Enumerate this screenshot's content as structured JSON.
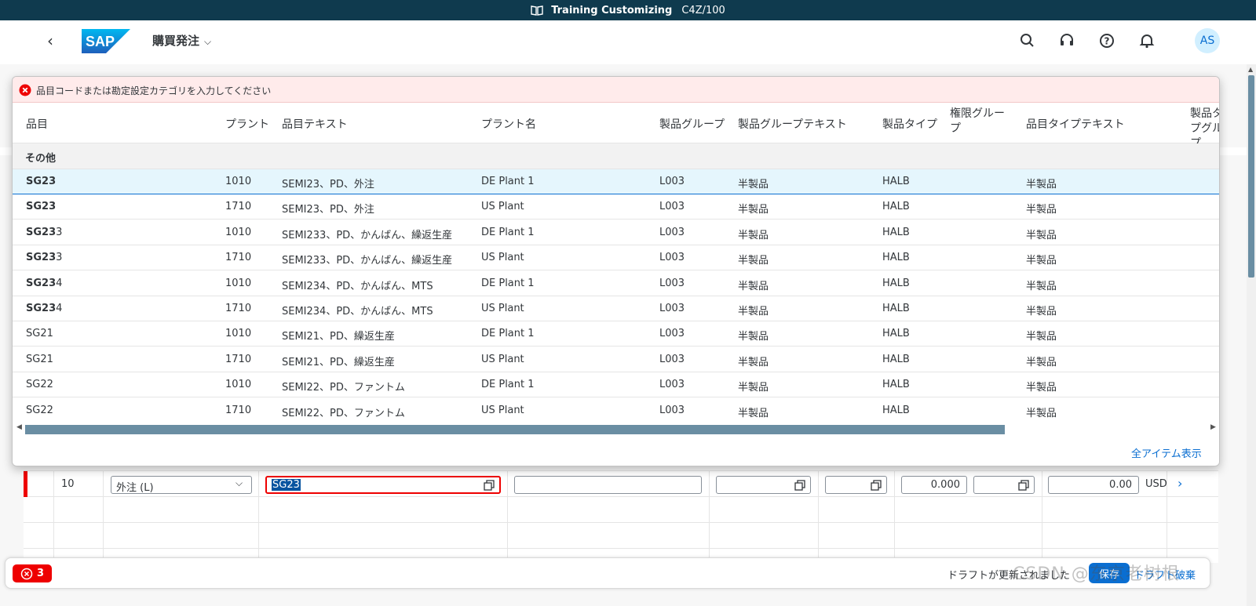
{
  "system_bar": {
    "title": "Training Customizing",
    "system": "C4Z/100"
  },
  "shell": {
    "app_title": "購買発注",
    "logo": "SAP",
    "avatar": "AS"
  },
  "colors": {
    "accent": "#0a6ed1",
    "error": "#e00000",
    "shell_bar": "#0f3a4e"
  },
  "popover": {
    "message": "品目コードまたは勘定設定カテゴリを入力してください",
    "columns": [
      "品目",
      "プラント",
      "品目テキスト",
      "プラント名",
      "製品グループ",
      "製品グループテキスト",
      "製品タイプ",
      "権限グループ",
      "品目タイプテキスト",
      "製品タイプグループ"
    ],
    "group_label": "その他",
    "rows": [
      {
        "item_bold": "SG23",
        "item_rest": "",
        "plant": "1010",
        "text": "SEMI23、PD、外注",
        "plant_name": "DE Plant 1",
        "group": "L003",
        "group_text": "半製品",
        "type": "HALB",
        "auth": "",
        "type_text": "半製品"
      },
      {
        "item_bold": "SG23",
        "item_rest": "",
        "plant": "1710",
        "text": "SEMI23、PD、外注",
        "plant_name": "US Plant",
        "group": "L003",
        "group_text": "半製品",
        "type": "HALB",
        "auth": "",
        "type_text": "半製品"
      },
      {
        "item_bold": "SG23",
        "item_rest": "3",
        "plant": "1010",
        "text": "SEMI233、PD、かんばん、繰返生産",
        "plant_name": "DE Plant 1",
        "group": "L003",
        "group_text": "半製品",
        "type": "HALB",
        "auth": "",
        "type_text": "半製品"
      },
      {
        "item_bold": "SG23",
        "item_rest": "3",
        "plant": "1710",
        "text": "SEMI233、PD、かんばん、繰返生産",
        "plant_name": "US Plant",
        "group": "L003",
        "group_text": "半製品",
        "type": "HALB",
        "auth": "",
        "type_text": "半製品"
      },
      {
        "item_bold": "SG23",
        "item_rest": "4",
        "plant": "1010",
        "text": "SEMI234、PD、かんばん、MTS",
        "plant_name": "DE Plant 1",
        "group": "L003",
        "group_text": "半製品",
        "type": "HALB",
        "auth": "",
        "type_text": "半製品"
      },
      {
        "item_bold": "SG23",
        "item_rest": "4",
        "plant": "1710",
        "text": "SEMI234、PD、かんばん、MTS",
        "plant_name": "US Plant",
        "group": "L003",
        "group_text": "半製品",
        "type": "HALB",
        "auth": "",
        "type_text": "半製品"
      },
      {
        "item_bold": "",
        "item_rest": "SG21",
        "plant": "1010",
        "text": "SEMI21、PD、繰返生産",
        "plant_name": "DE Plant 1",
        "group": "L003",
        "group_text": "半製品",
        "type": "HALB",
        "auth": "",
        "type_text": "半製品"
      },
      {
        "item_bold": "",
        "item_rest": "SG21",
        "plant": "1710",
        "text": "SEMI21、PD、繰返生産",
        "plant_name": "US Plant",
        "group": "L003",
        "group_text": "半製品",
        "type": "HALB",
        "auth": "",
        "type_text": "半製品"
      },
      {
        "item_bold": "",
        "item_rest": "SG22",
        "plant": "1010",
        "text": "SEMI22、PD、ファントム",
        "plant_name": "DE Plant 1",
        "group": "L003",
        "group_text": "半製品",
        "type": "HALB",
        "auth": "",
        "type_text": "半製品"
      },
      {
        "item_bold": "",
        "item_rest": "SG22",
        "plant": "1710",
        "text": "SEMI22、PD、ファントム",
        "plant_name": "US Plant",
        "group": "L003",
        "group_text": "半製品",
        "type": "HALB",
        "auth": "",
        "type_text": "半製品"
      }
    ],
    "show_all": "全アイテム表示"
  },
  "item_row": {
    "item_no": "10",
    "category": "外注 (L)",
    "material": "SG23",
    "quantity": "0.000",
    "price": "0.00",
    "currency": "USD"
  },
  "footer": {
    "error_count": "3",
    "status_text": "ドラフトが更新されました",
    "save_button": "保存",
    "discard_button": "ドラフト破棄"
  },
  "watermark": "CSDN @东京老树根"
}
